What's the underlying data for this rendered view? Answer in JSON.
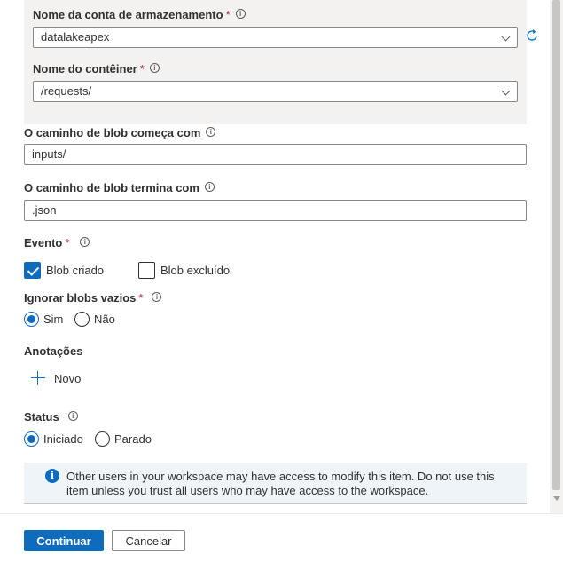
{
  "storage_account": {
    "label": "Nome da conta de armazenamento",
    "required_mark": "*",
    "value": "datalakeapex"
  },
  "container": {
    "label": "Nome do contêiner",
    "required_mark": "*",
    "value": "/requests/"
  },
  "blob_begins": {
    "label": "O caminho de blob começa com",
    "value": "inputs/"
  },
  "blob_ends": {
    "label": "O caminho de blob termina com",
    "value": ".json"
  },
  "event": {
    "label": "Evento",
    "required_mark": "*",
    "options": [
      {
        "label": "Blob criado",
        "checked": true
      },
      {
        "label": "Blob excluído",
        "checked": false
      }
    ]
  },
  "ignore_empty": {
    "label": "Ignorar blobs vazios",
    "required_mark": "*",
    "options": [
      {
        "label": "Sim",
        "selected": true
      },
      {
        "label": "Não",
        "selected": false
      }
    ]
  },
  "annotations": {
    "label": "Anotações",
    "add_label": "Novo"
  },
  "status": {
    "label": "Status",
    "options": [
      {
        "label": "Iniciado",
        "selected": true
      },
      {
        "label": "Parado",
        "selected": false
      }
    ]
  },
  "info_bar": {
    "icon": "info-icon",
    "text": "Other users in your workspace may have access to modify this item. Do not use this item unless you trust all users who may have access to the workspace."
  },
  "footer": {
    "continue_label": "Continuar",
    "cancel_label": "Cancelar"
  },
  "colors": {
    "accent": "#0f6cbd",
    "required": "#a4262c",
    "group_bg": "#f3f2f1",
    "info_bg": "#eff4f9"
  }
}
